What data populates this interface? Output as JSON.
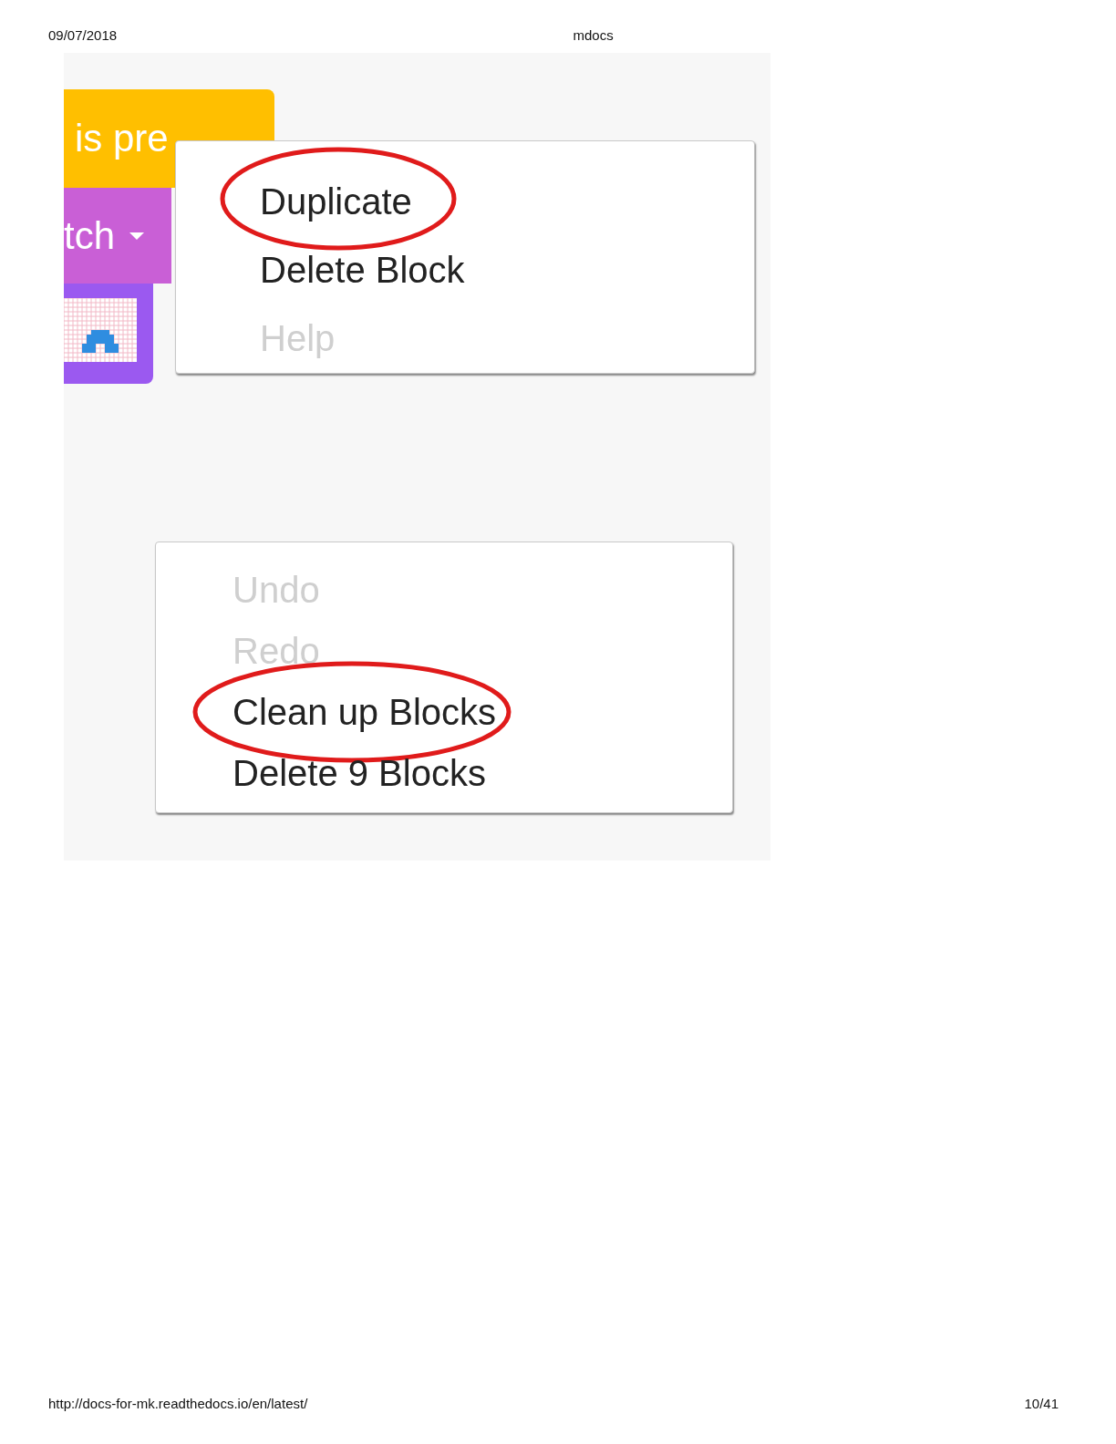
{
  "header": {
    "date": "09/07/2018",
    "title": "mdocs"
  },
  "blocks": [
    {
      "kind": "event",
      "text": "is pre",
      "color": "#ffbf00"
    },
    {
      "kind": "dropdown",
      "text": "tch",
      "color": "#c95fd6"
    },
    {
      "kind": "image",
      "color": "#9b59f0"
    }
  ],
  "block_menu": {
    "items": [
      {
        "label": "Duplicate",
        "disabled": false,
        "circled": true
      },
      {
        "label": "Delete Block",
        "disabled": false,
        "circled": false
      },
      {
        "label": "Help",
        "disabled": true,
        "circled": false
      }
    ]
  },
  "workspace_menu": {
    "items": [
      {
        "label": "Undo",
        "disabled": true,
        "circled": false
      },
      {
        "label": "Redo",
        "disabled": true,
        "circled": false
      },
      {
        "label": "Clean up Blocks",
        "disabled": false,
        "circled": true
      },
      {
        "label": "Delete 9 Blocks",
        "disabled": false,
        "circled": false
      }
    ]
  },
  "footer": {
    "url": "http://docs-for-mk.readthedocs.io/en/latest/",
    "page": "10/41"
  }
}
